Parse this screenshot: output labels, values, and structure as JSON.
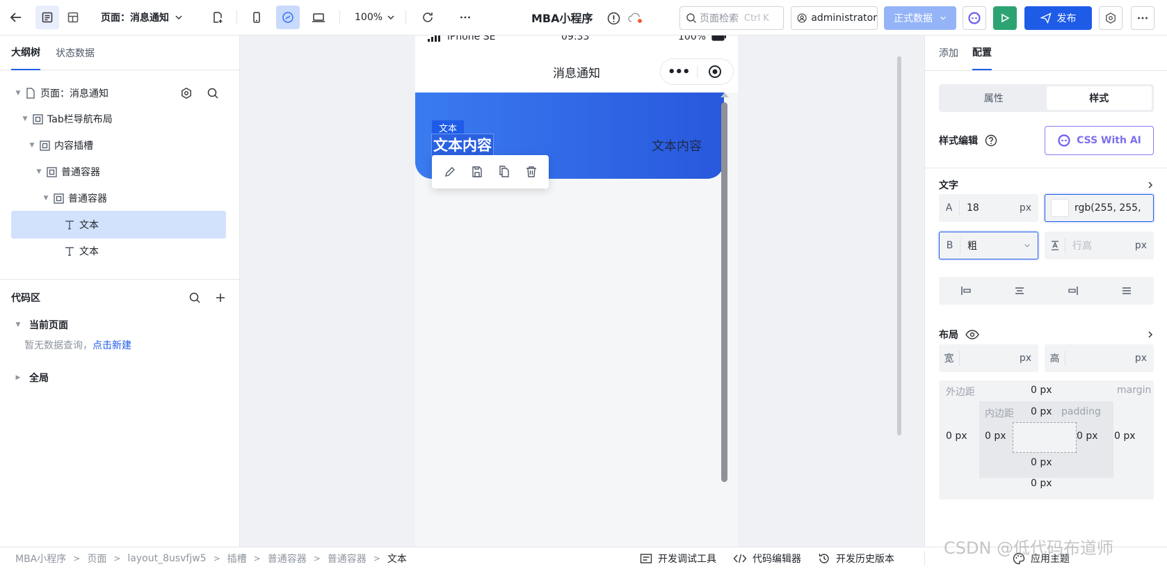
{
  "header": {
    "page_select": "页面：消息通知",
    "zoom": "100%",
    "app_title": "MBA小程序",
    "search_placeholder": "页面检索",
    "search_shortcut": "Ctrl K",
    "username": "administrator",
    "env_label": "正式数据",
    "publish_label": "发布"
  },
  "left": {
    "tabs": [
      "大纲树",
      "状态数据"
    ],
    "tree": [
      {
        "label": "页面：消息通知",
        "depth": 0
      },
      {
        "label": "Tab栏导航布局",
        "depth": 1
      },
      {
        "label": "内容插槽",
        "depth": 2
      },
      {
        "label": "普通容器",
        "depth": 3
      },
      {
        "label": "普通容器",
        "depth": 4
      },
      {
        "label": "文本",
        "depth": 5,
        "selected": true
      },
      {
        "label": "文本",
        "depth": 5
      }
    ],
    "code_title": "代码区",
    "current_page": "当前页面",
    "empty_text": "暂无数据查询，",
    "empty_link": "点击新建",
    "global": "全局"
  },
  "phone": {
    "device": "iPhone SE",
    "time": "09:33",
    "battery": "100%",
    "nav_title": "消息通知",
    "selected_tag": "文本",
    "selected_text": "文本内容",
    "right_text": "文本内容"
  },
  "right": {
    "tabs": [
      "添加",
      "配置"
    ],
    "segments": [
      "属性",
      "样式"
    ],
    "style_edit": "样式编辑",
    "css_ai": "CSS With AI",
    "text_section": "文字",
    "font_size_label": "A",
    "font_size": "18",
    "unit": "px",
    "color_value": "rgb(255, 255,",
    "weight_label": "B",
    "weight": "粗",
    "line_height_placeholder": "行高",
    "layout_section": "布局",
    "width_label": "宽",
    "height_label": "高",
    "margin_label": "外边距",
    "margin_en": "margin",
    "padding_label": "内边距",
    "padding_en": "padding",
    "zero": "0 px"
  },
  "bottom": {
    "breadcrumbs": [
      "MBA小程序",
      "页面",
      "layout_8usvfjw5",
      "插槽",
      "普通容器",
      "普通容器",
      "文本"
    ],
    "dev_tools": "开发调试工具",
    "code_editor": "代码编辑器",
    "history": "开发历史版本",
    "theme": "应用主题",
    "watermark": "CSDN @低代码布道师"
  },
  "colors": {
    "primary": "#1e5ce8",
    "run": "#2ba471",
    "banner_start": "#3a7bf0",
    "banner_end": "#2858dd",
    "selected_row": "#d3e2fc"
  }
}
